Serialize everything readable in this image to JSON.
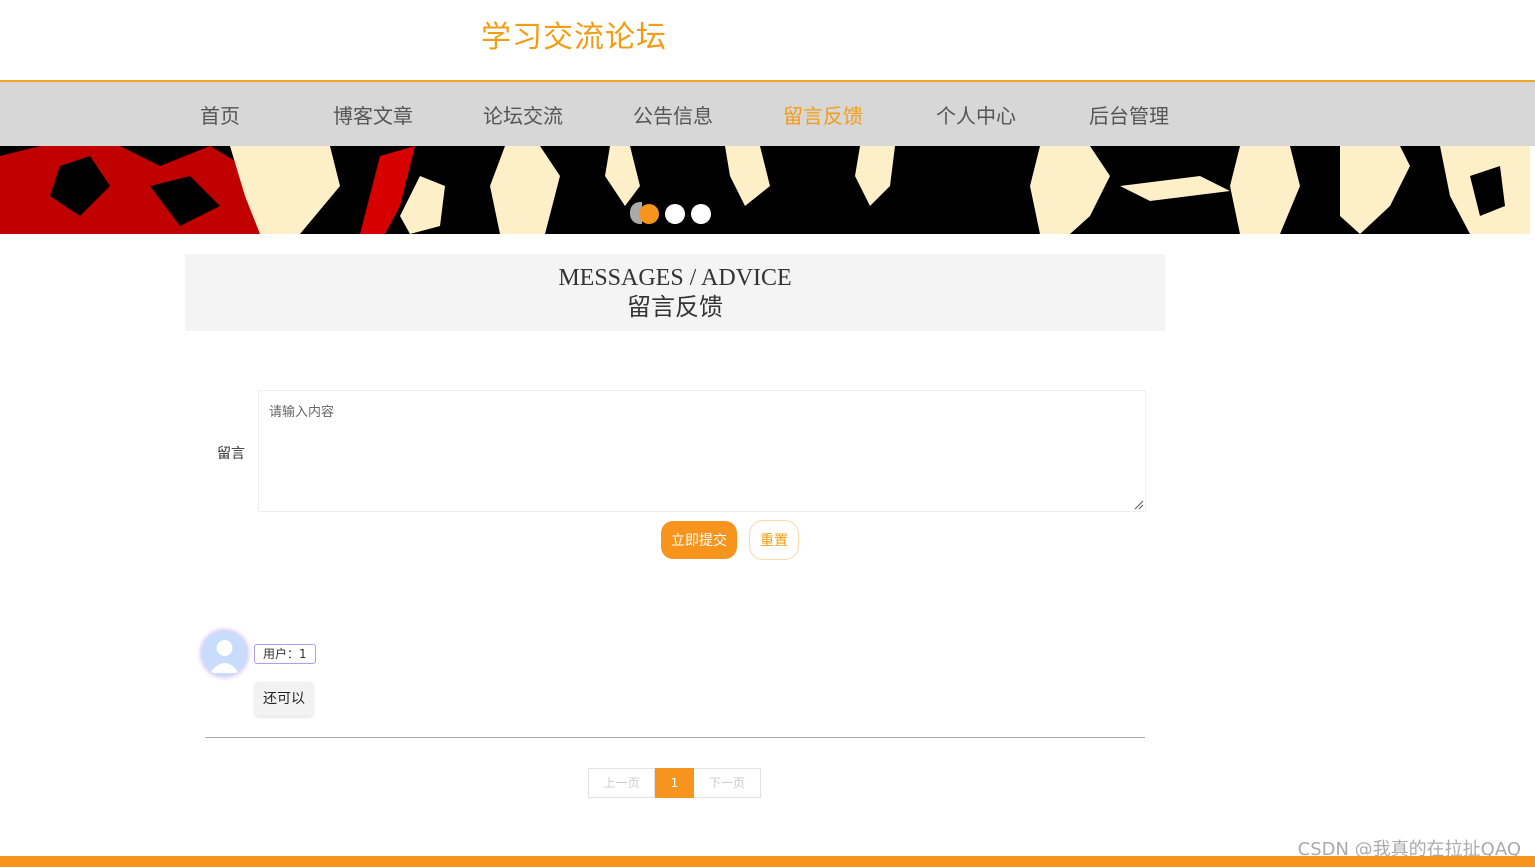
{
  "header": {
    "title": "学习交流论坛"
  },
  "nav": {
    "items": [
      {
        "label": "首页"
      },
      {
        "label": "博客文章"
      },
      {
        "label": "论坛交流"
      },
      {
        "label": "公告信息"
      },
      {
        "label": "留言反馈",
        "active": true
      },
      {
        "label": "个人中心"
      },
      {
        "label": "后台管理"
      }
    ]
  },
  "banner": {
    "slide_count": 3,
    "active_slide": 1
  },
  "section": {
    "title_en": "MESSAGES / ADVICE",
    "title_cn": "留言反馈"
  },
  "form": {
    "label": "留言",
    "placeholder": "请输入内容",
    "value": "",
    "submit_label": "立即提交",
    "reset_label": "重置"
  },
  "messages": [
    {
      "user": "用户：1",
      "content": "还可以"
    }
  ],
  "pagination": {
    "prev_label": "上一页",
    "current": "1",
    "next_label": "下一页"
  },
  "watermark": "CSDN @我真的在拉扯QAQ",
  "colors": {
    "accent": "#f7941d",
    "title": "#f39c12",
    "nav_bg": "#d7d7d7"
  }
}
